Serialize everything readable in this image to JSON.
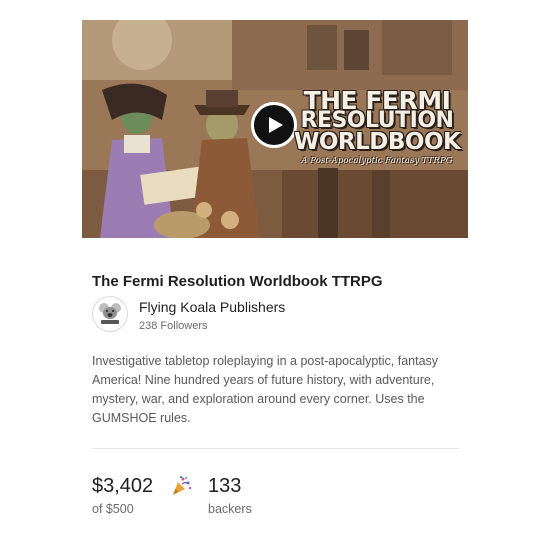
{
  "hero": {
    "title_line1": "THE FERMI",
    "title_line2": "RESOLUTION",
    "title_line3": "WORLDBOOK",
    "subtitle": "A Post-Apocalyptic Fantasy TTRPG",
    "play_icon": "play-icon"
  },
  "project": {
    "title": "The Fermi Resolution Worldbook TTRPG",
    "description": "Investigative tabletop roleplaying in a post-apocalyptic, fantasy America! Nine hundred years of future history, with adventure, mystery, war, and exploration around every corner. Uses the GUMSHOE rules."
  },
  "creator": {
    "name": "Flying Koala Publishers",
    "followers": "238 Followers",
    "avatar_icon": "koala-logo-icon"
  },
  "stats": {
    "amount": "$3,402",
    "goal": "of $500",
    "backers_count": "133",
    "backers_label": "backers",
    "celebration_icon": "party-popper-icon"
  },
  "colors": {
    "text_primary": "#1f1f1f",
    "text_secondary": "#6b6b6b",
    "divider": "#e6e6e6"
  }
}
